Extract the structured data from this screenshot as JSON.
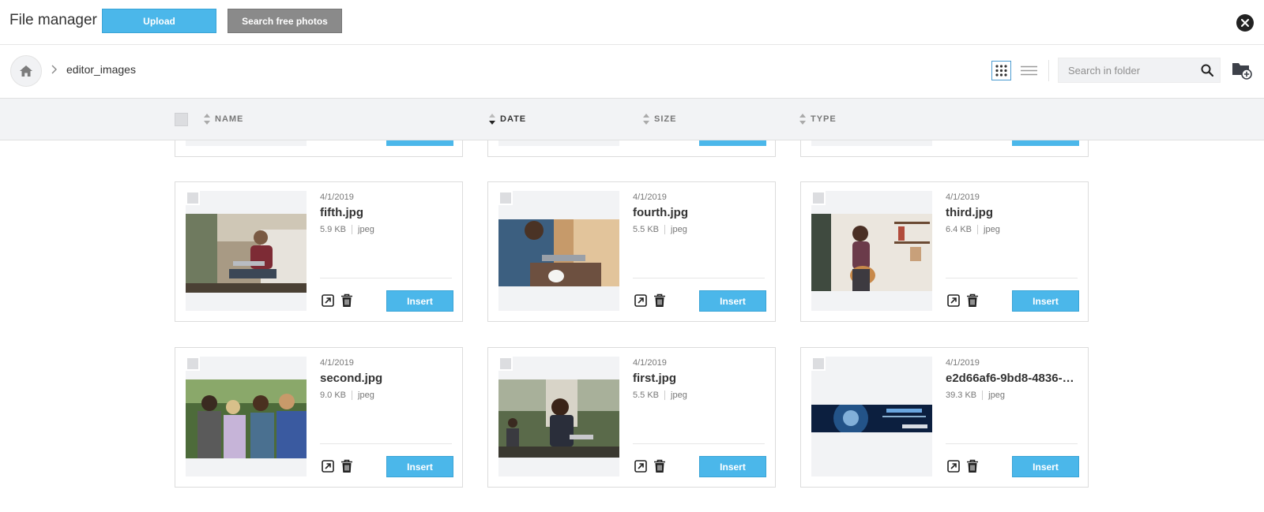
{
  "header": {
    "title": "File manager",
    "upload_label": "Upload",
    "search_photos_label": "Search free photos"
  },
  "breadcrumb": {
    "folder": "editor_images"
  },
  "search": {
    "placeholder": "Search in folder"
  },
  "columns": {
    "name": "NAME",
    "date": "DATE",
    "size": "SIZE",
    "type": "TYPE"
  },
  "colors": {
    "accent": "#4bb7ea",
    "secondary_button": "#8a8a8a",
    "header_bg": "#f2f3f5"
  },
  "files": [
    {
      "date": "4/1/2019",
      "name": "fifth.jpg",
      "size": "5.9 KB",
      "type": "jpeg",
      "insert_label": "Insert"
    },
    {
      "date": "4/1/2019",
      "name": "fourth.jpg",
      "size": "5.5 KB",
      "type": "jpeg",
      "insert_label": "Insert"
    },
    {
      "date": "4/1/2019",
      "name": "third.jpg",
      "size": "6.4 KB",
      "type": "jpeg",
      "insert_label": "Insert"
    },
    {
      "date": "4/1/2019",
      "name": "second.jpg",
      "size": "9.0 KB",
      "type": "jpeg",
      "insert_label": "Insert"
    },
    {
      "date": "4/1/2019",
      "name": "first.jpg",
      "size": "5.5 KB",
      "type": "jpeg",
      "insert_label": "Insert"
    },
    {
      "date": "4/1/2019",
      "name": "e2d66af6-9bd8-4836-…",
      "size": "39.3 KB",
      "type": "jpeg",
      "insert_label": "Insert"
    }
  ]
}
